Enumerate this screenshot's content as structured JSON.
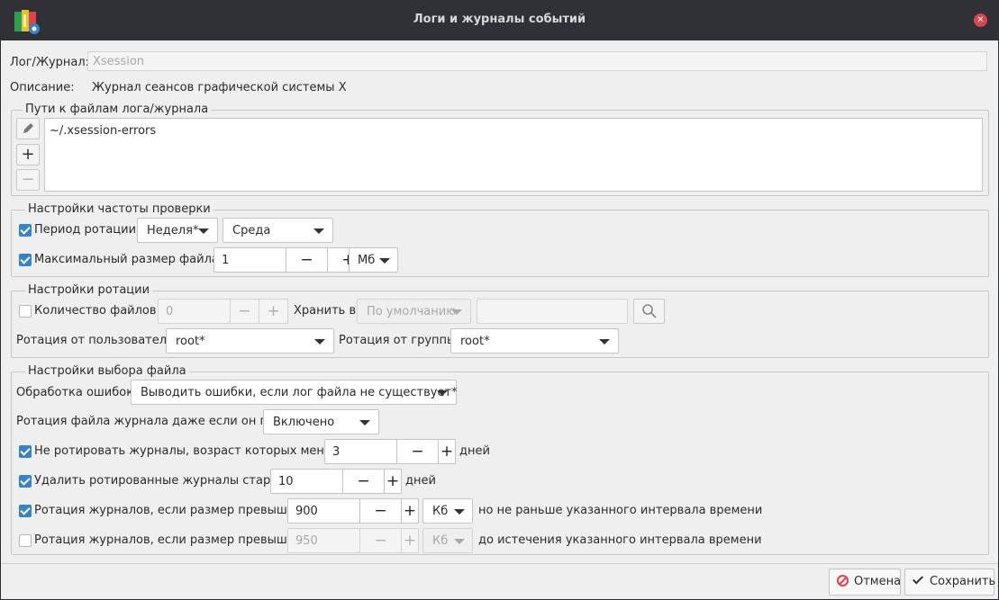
{
  "window": {
    "title": "Логи и журналы событий",
    "close_icon": "close-icon",
    "app_icon": "log-app-icon"
  },
  "log": {
    "label": "Лог/Журнал:",
    "value": "Xsession"
  },
  "description": {
    "label": "Описание:",
    "value": "Журнал сеансов графической системы X"
  },
  "paths": {
    "title": "Пути к файлам лога/журнала",
    "items": [
      "~/.xsession-errors"
    ],
    "tools": [
      "edit-icon",
      "add-icon",
      "remove-icon"
    ]
  },
  "frequency": {
    "title": "Настройки частоты проверки",
    "period_label": "Период ротации:",
    "period_checked": true,
    "period_value": "Неделя*",
    "day_value": "Среда",
    "maxsize_label": "Максимальный размер файла:",
    "maxsize_checked": true,
    "maxsize_value": "1",
    "maxsize_unit": "Мб",
    "minus": "−",
    "plus": "+"
  },
  "rotation": {
    "title": "Настройки ротации",
    "count_label": "Количество файлов:",
    "count_checked": false,
    "count_value": "0",
    "store_label": "Хранить в:",
    "store_value": "По умолчанию",
    "store_path": "",
    "user_label": "Ротация от пользователя:",
    "user_value": "root*",
    "group_label": "Ротация от группы:",
    "group_value": "root*"
  },
  "file": {
    "title": "Настройки выбора файла",
    "errors_label": "Обработка ошибок:",
    "errors_value": "Выводить ошибки, если лог файла не существует*",
    "empty_label": "Ротация файла журнала даже если он пуст:",
    "empty_value": "Включено",
    "minage_label": "Не ротировать журналы, возраст которых меньше",
    "minage_checked": true,
    "minage_value": "3",
    "minage_unit": "дней",
    "maxage_label": "Удалить ротированные журналы старше",
    "maxage_checked": true,
    "maxage_value": "10",
    "maxage_unit": "дней",
    "size1_label": "Ротация журналов, если размер превышает",
    "size1_checked": true,
    "size1_value": "900",
    "size1_unit": "Кб",
    "size1_suffix": "но не раньше указанного интервала времени",
    "size2_label": "Ротация журналов, если размер превышает",
    "size2_checked": false,
    "size2_value": "950",
    "size2_unit": "Кб",
    "size2_suffix": "до истечения указанного интервала времени"
  },
  "buttons": {
    "cancel": "Отмена",
    "save": "Сохранить"
  }
}
